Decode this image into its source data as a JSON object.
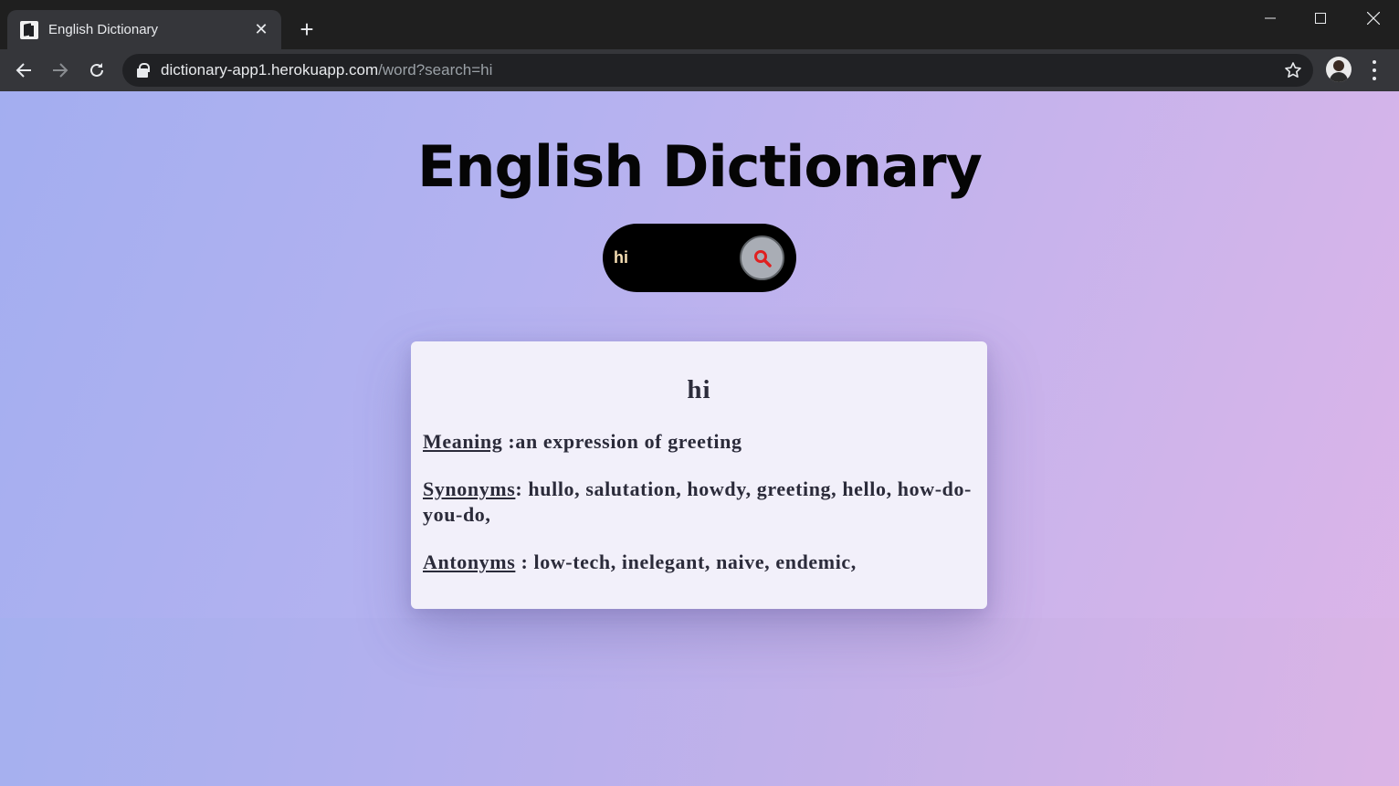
{
  "browser": {
    "tab_title": "English Dictionary",
    "url_host": "dictionary-app1.herokuapp.com",
    "url_path": "/word?search=hi"
  },
  "page": {
    "title": "English Dictionary",
    "search_value": "hi",
    "search_icon": "magnifier-icon",
    "accent_color": "#e02020"
  },
  "result": {
    "word": "hi",
    "meaning_label": "Meaning",
    "meaning_text": " :an expression of greeting",
    "synonyms_label": "Synonyms",
    "synonyms_text": ": hullo, salutation, howdy, greeting, hello, how-do-you-do,",
    "antonyms_label": "Antonyms",
    "antonyms_text": " : low-tech, inelegant, naive, endemic,"
  }
}
